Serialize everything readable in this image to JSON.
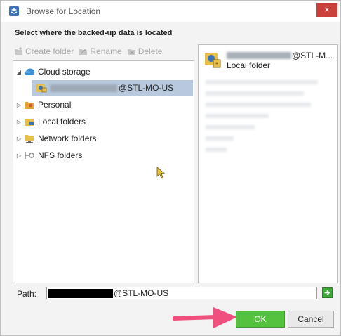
{
  "window": {
    "title": "Browse for Location",
    "close_label": "×"
  },
  "instruction": "Select where the backed-up data is located",
  "toolbar": {
    "create_folder": "Create folder",
    "rename": "Rename",
    "delete": "Delete"
  },
  "tree": {
    "cloud_storage": "Cloud storage",
    "selected_suffix": "@STL-MO-US",
    "personal": "Personal",
    "local_folders": "Local folders",
    "network_folders": "Network folders",
    "nfs_folders": "NFS folders"
  },
  "detail": {
    "name_suffix": "@STL-M...",
    "type": "Local folder"
  },
  "path": {
    "label": "Path:",
    "value_suffix": "@STL-MO-US"
  },
  "buttons": {
    "ok": "OK",
    "cancel": "Cancel"
  },
  "colors": {
    "accent_green": "#54c23e",
    "selection": "#b8c9dd",
    "close_red": "#c9413a",
    "arrow_pink": "#f0507e"
  }
}
